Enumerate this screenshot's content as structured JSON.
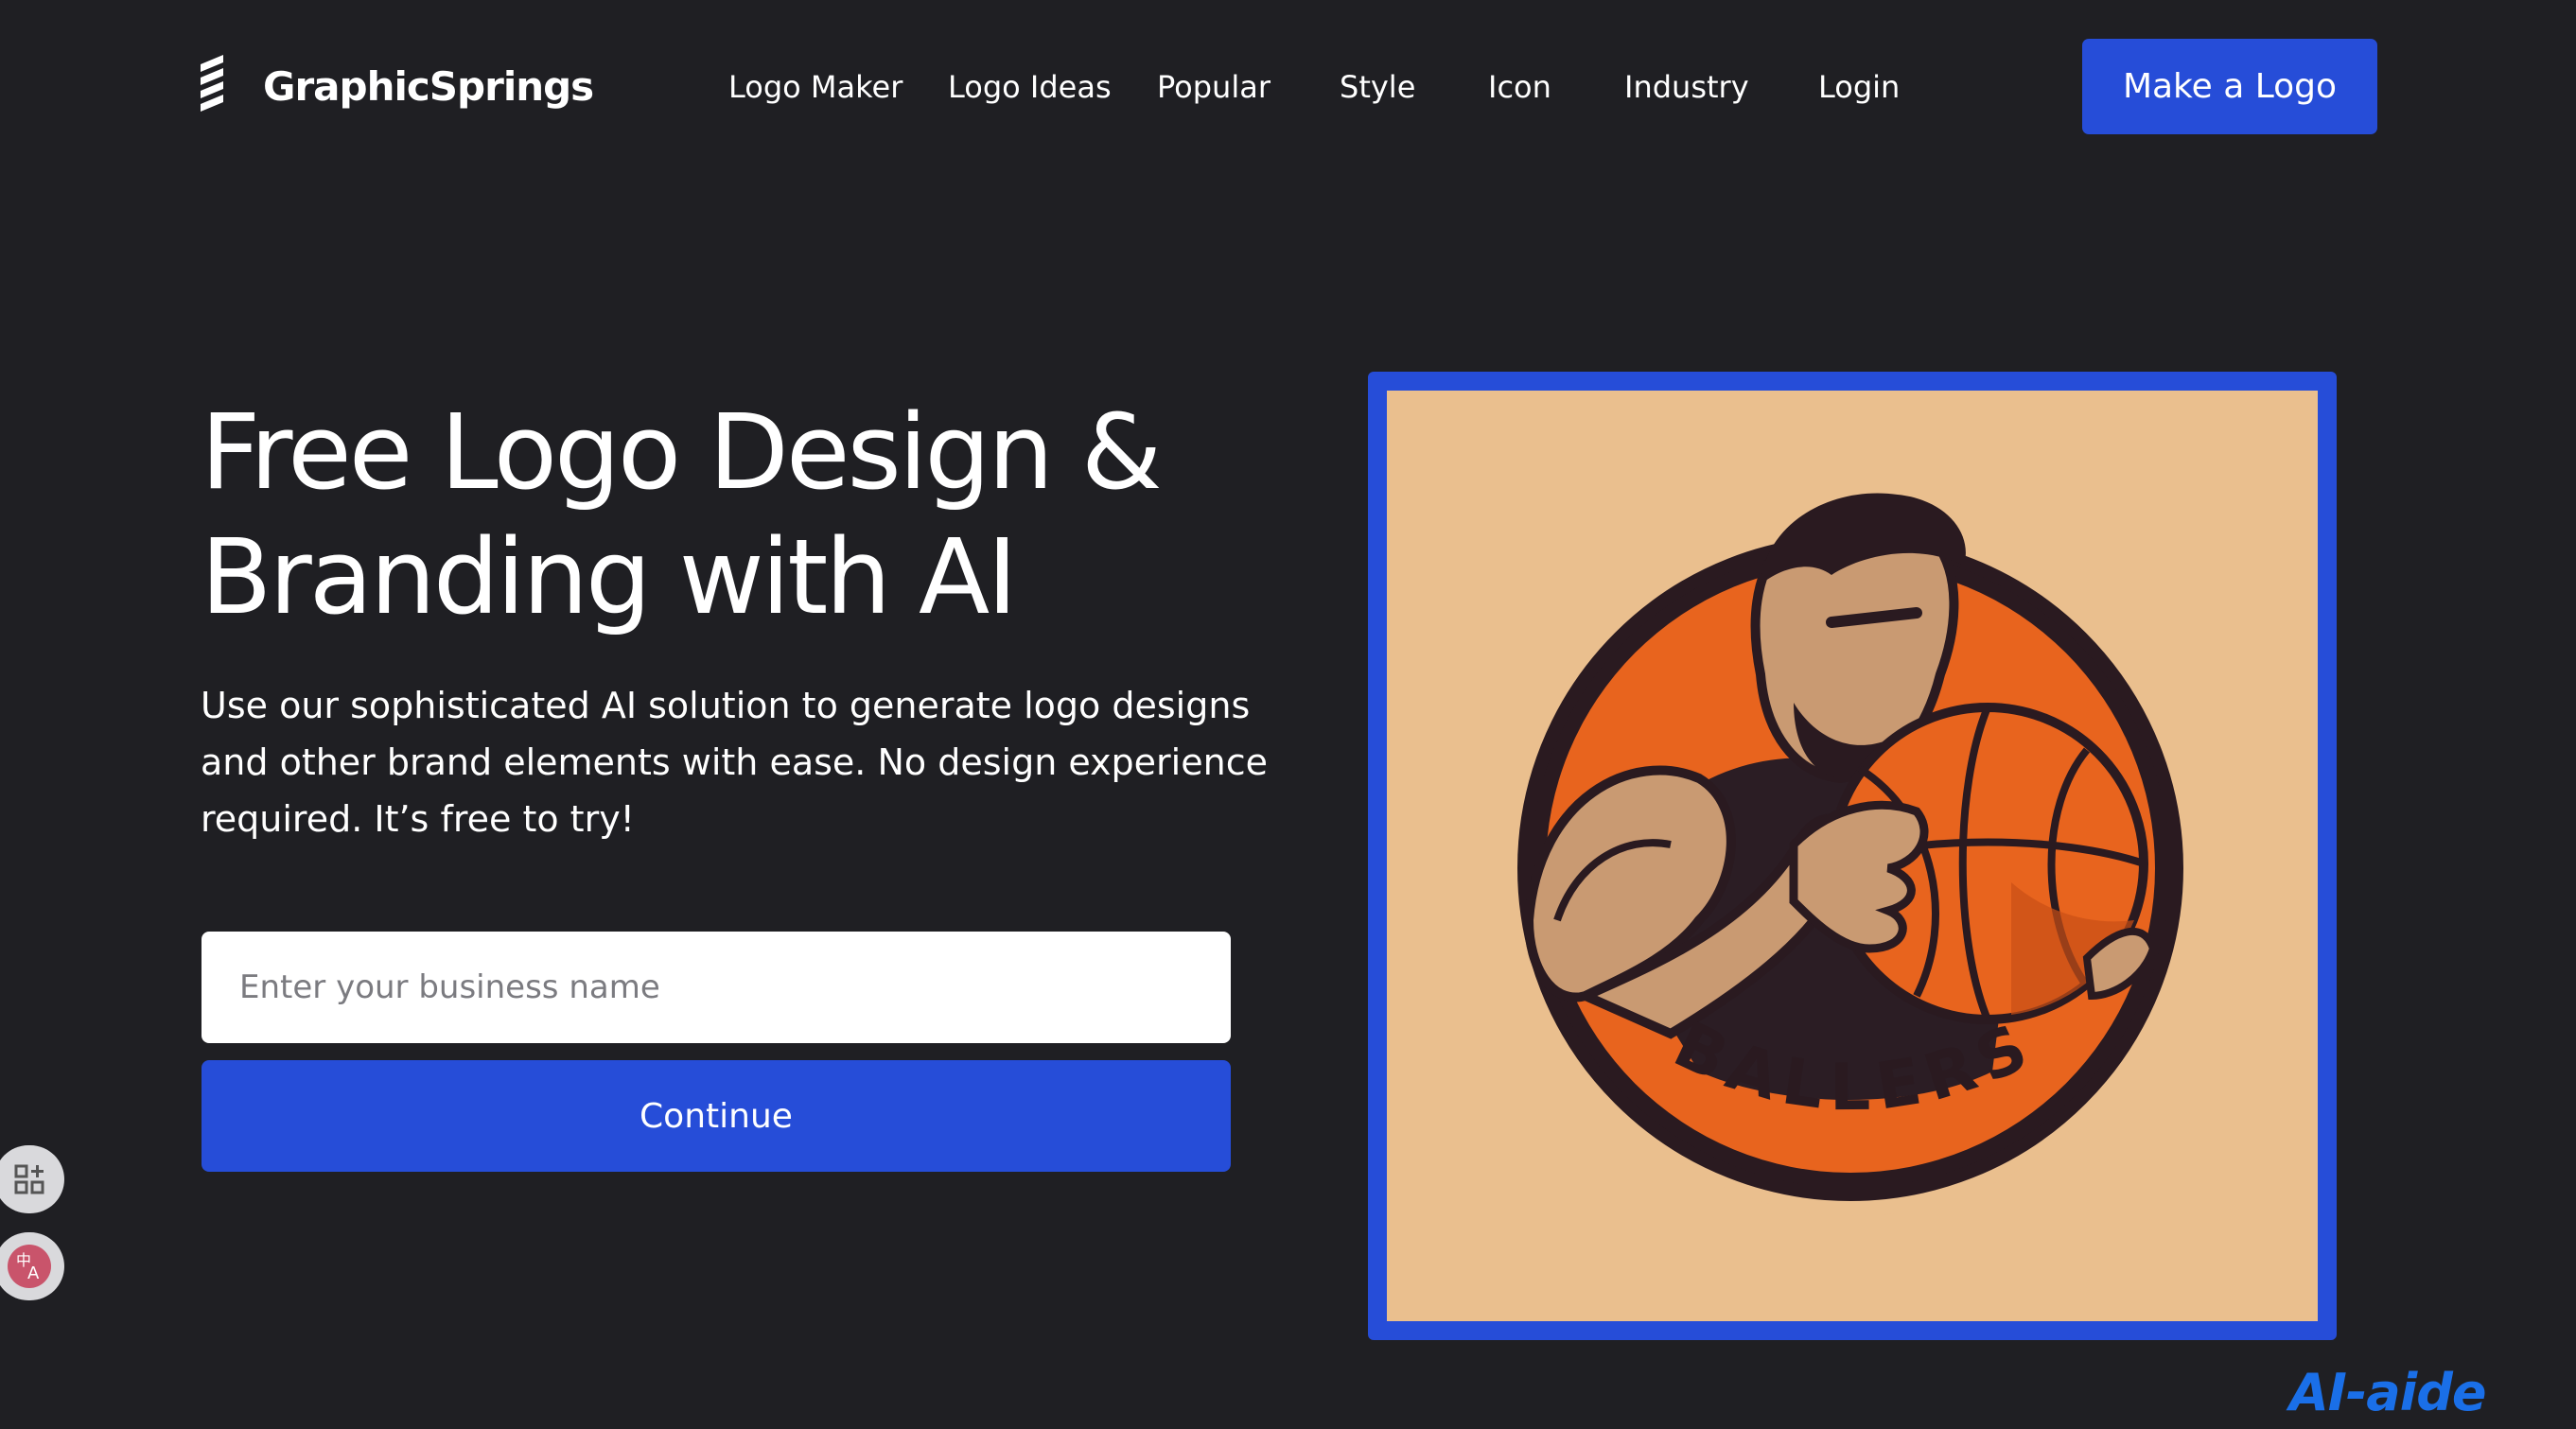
{
  "header": {
    "brand_name": "GraphicSprings",
    "nav": [
      {
        "label": "Logo Maker"
      },
      {
        "label": "Logo Ideas"
      },
      {
        "label": "Popular"
      },
      {
        "label": "Style"
      },
      {
        "label": "Icon"
      },
      {
        "label": "Industry"
      },
      {
        "label": "Login"
      }
    ],
    "cta_label": "Make a Logo"
  },
  "hero": {
    "title_lines": [
      "Free Logo Design &",
      "Branding with AI"
    ],
    "description_lines": [
      "Use our sophisticated AI solution to generate logo designs",
      "and other brand elements with ease. No design experience",
      "required. It’s free to try!"
    ],
    "input_placeholder": "Enter your business name",
    "input_value": "",
    "continue_label": "Continue",
    "image_text": "BALLERS"
  },
  "side_tools": [
    {
      "icon": "apps-add-icon"
    },
    {
      "icon": "translate-icon"
    }
  ],
  "watermark": "AI-aide",
  "colors": {
    "background": "#1f1f23",
    "accent": "#264dd8",
    "image_background": "#eabf8e",
    "basketball_orange": "#e8641e"
  }
}
